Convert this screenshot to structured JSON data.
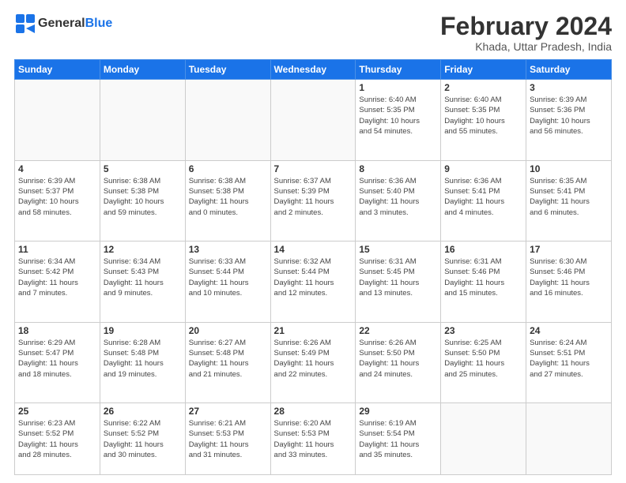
{
  "header": {
    "logo_line1": "General",
    "logo_line2": "Blue",
    "main_title": "February 2024",
    "subtitle": "Khada, Uttar Pradesh, India"
  },
  "weekdays": [
    "Sunday",
    "Monday",
    "Tuesday",
    "Wednesday",
    "Thursday",
    "Friday",
    "Saturday"
  ],
  "weeks": [
    [
      {
        "day": "",
        "info": ""
      },
      {
        "day": "",
        "info": ""
      },
      {
        "day": "",
        "info": ""
      },
      {
        "day": "",
        "info": ""
      },
      {
        "day": "1",
        "info": "Sunrise: 6:40 AM\nSunset: 5:35 PM\nDaylight: 10 hours\nand 54 minutes."
      },
      {
        "day": "2",
        "info": "Sunrise: 6:40 AM\nSunset: 5:35 PM\nDaylight: 10 hours\nand 55 minutes."
      },
      {
        "day": "3",
        "info": "Sunrise: 6:39 AM\nSunset: 5:36 PM\nDaylight: 10 hours\nand 56 minutes."
      }
    ],
    [
      {
        "day": "4",
        "info": "Sunrise: 6:39 AM\nSunset: 5:37 PM\nDaylight: 10 hours\nand 58 minutes."
      },
      {
        "day": "5",
        "info": "Sunrise: 6:38 AM\nSunset: 5:38 PM\nDaylight: 10 hours\nand 59 minutes."
      },
      {
        "day": "6",
        "info": "Sunrise: 6:38 AM\nSunset: 5:38 PM\nDaylight: 11 hours\nand 0 minutes."
      },
      {
        "day": "7",
        "info": "Sunrise: 6:37 AM\nSunset: 5:39 PM\nDaylight: 11 hours\nand 2 minutes."
      },
      {
        "day": "8",
        "info": "Sunrise: 6:36 AM\nSunset: 5:40 PM\nDaylight: 11 hours\nand 3 minutes."
      },
      {
        "day": "9",
        "info": "Sunrise: 6:36 AM\nSunset: 5:41 PM\nDaylight: 11 hours\nand 4 minutes."
      },
      {
        "day": "10",
        "info": "Sunrise: 6:35 AM\nSunset: 5:41 PM\nDaylight: 11 hours\nand 6 minutes."
      }
    ],
    [
      {
        "day": "11",
        "info": "Sunrise: 6:34 AM\nSunset: 5:42 PM\nDaylight: 11 hours\nand 7 minutes."
      },
      {
        "day": "12",
        "info": "Sunrise: 6:34 AM\nSunset: 5:43 PM\nDaylight: 11 hours\nand 9 minutes."
      },
      {
        "day": "13",
        "info": "Sunrise: 6:33 AM\nSunset: 5:44 PM\nDaylight: 11 hours\nand 10 minutes."
      },
      {
        "day": "14",
        "info": "Sunrise: 6:32 AM\nSunset: 5:44 PM\nDaylight: 11 hours\nand 12 minutes."
      },
      {
        "day": "15",
        "info": "Sunrise: 6:31 AM\nSunset: 5:45 PM\nDaylight: 11 hours\nand 13 minutes."
      },
      {
        "day": "16",
        "info": "Sunrise: 6:31 AM\nSunset: 5:46 PM\nDaylight: 11 hours\nand 15 minutes."
      },
      {
        "day": "17",
        "info": "Sunrise: 6:30 AM\nSunset: 5:46 PM\nDaylight: 11 hours\nand 16 minutes."
      }
    ],
    [
      {
        "day": "18",
        "info": "Sunrise: 6:29 AM\nSunset: 5:47 PM\nDaylight: 11 hours\nand 18 minutes."
      },
      {
        "day": "19",
        "info": "Sunrise: 6:28 AM\nSunset: 5:48 PM\nDaylight: 11 hours\nand 19 minutes."
      },
      {
        "day": "20",
        "info": "Sunrise: 6:27 AM\nSunset: 5:48 PM\nDaylight: 11 hours\nand 21 minutes."
      },
      {
        "day": "21",
        "info": "Sunrise: 6:26 AM\nSunset: 5:49 PM\nDaylight: 11 hours\nand 22 minutes."
      },
      {
        "day": "22",
        "info": "Sunrise: 6:26 AM\nSunset: 5:50 PM\nDaylight: 11 hours\nand 24 minutes."
      },
      {
        "day": "23",
        "info": "Sunrise: 6:25 AM\nSunset: 5:50 PM\nDaylight: 11 hours\nand 25 minutes."
      },
      {
        "day": "24",
        "info": "Sunrise: 6:24 AM\nSunset: 5:51 PM\nDaylight: 11 hours\nand 27 minutes."
      }
    ],
    [
      {
        "day": "25",
        "info": "Sunrise: 6:23 AM\nSunset: 5:52 PM\nDaylight: 11 hours\nand 28 minutes."
      },
      {
        "day": "26",
        "info": "Sunrise: 6:22 AM\nSunset: 5:52 PM\nDaylight: 11 hours\nand 30 minutes."
      },
      {
        "day": "27",
        "info": "Sunrise: 6:21 AM\nSunset: 5:53 PM\nDaylight: 11 hours\nand 31 minutes."
      },
      {
        "day": "28",
        "info": "Sunrise: 6:20 AM\nSunset: 5:53 PM\nDaylight: 11 hours\nand 33 minutes."
      },
      {
        "day": "29",
        "info": "Sunrise: 6:19 AM\nSunset: 5:54 PM\nDaylight: 11 hours\nand 35 minutes."
      },
      {
        "day": "",
        "info": ""
      },
      {
        "day": "",
        "info": ""
      }
    ]
  ]
}
